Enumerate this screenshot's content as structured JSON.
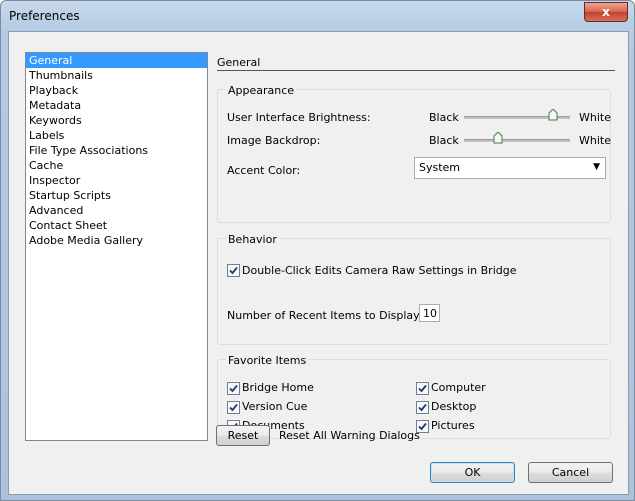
{
  "window": {
    "title": "Preferences",
    "close_glyph": "x"
  },
  "sidebar": {
    "items": [
      {
        "label": "General",
        "selected": true
      },
      {
        "label": "Thumbnails"
      },
      {
        "label": "Playback"
      },
      {
        "label": "Metadata"
      },
      {
        "label": "Keywords"
      },
      {
        "label": "Labels"
      },
      {
        "label": "File Type Associations"
      },
      {
        "label": "Cache"
      },
      {
        "label": "Inspector"
      },
      {
        "label": "Startup Scripts"
      },
      {
        "label": "Advanced"
      },
      {
        "label": "Contact Sheet"
      },
      {
        "label": "Adobe Media Gallery"
      }
    ]
  },
  "general": {
    "heading": "General",
    "appearance": {
      "label": "Appearance",
      "ui_brightness": {
        "label": "User Interface Brightness:",
        "min_label": "Black",
        "max_label": "White",
        "value": 0.87
      },
      "image_backdrop": {
        "label": "Image Backdrop:",
        "min_label": "Black",
        "max_label": "White",
        "value": 0.3
      },
      "accent_color": {
        "label": "Accent Color:",
        "value": "System"
      }
    },
    "behavior": {
      "label": "Behavior",
      "camera_raw": {
        "label": "Double-Click Edits Camera Raw Settings in Bridge",
        "checked": true
      },
      "recent_items": {
        "label": "Number of Recent Items to Display:",
        "value": "10"
      }
    },
    "favorites": {
      "label": "Favorite Items",
      "left": [
        {
          "label": "Bridge Home",
          "checked": true
        },
        {
          "label": "Version Cue",
          "checked": true
        },
        {
          "label": "Documents",
          "checked": true
        }
      ],
      "right": [
        {
          "label": "Computer",
          "checked": true
        },
        {
          "label": "Desktop",
          "checked": true
        },
        {
          "label": "Pictures",
          "checked": true
        }
      ]
    },
    "reset": {
      "button": "Reset",
      "label": "Reset All Warning Dialogs"
    }
  },
  "footer": {
    "ok": "OK",
    "cancel": "Cancel"
  },
  "colors": {
    "selection": "#3399ff",
    "close_button": "#c2402a"
  }
}
